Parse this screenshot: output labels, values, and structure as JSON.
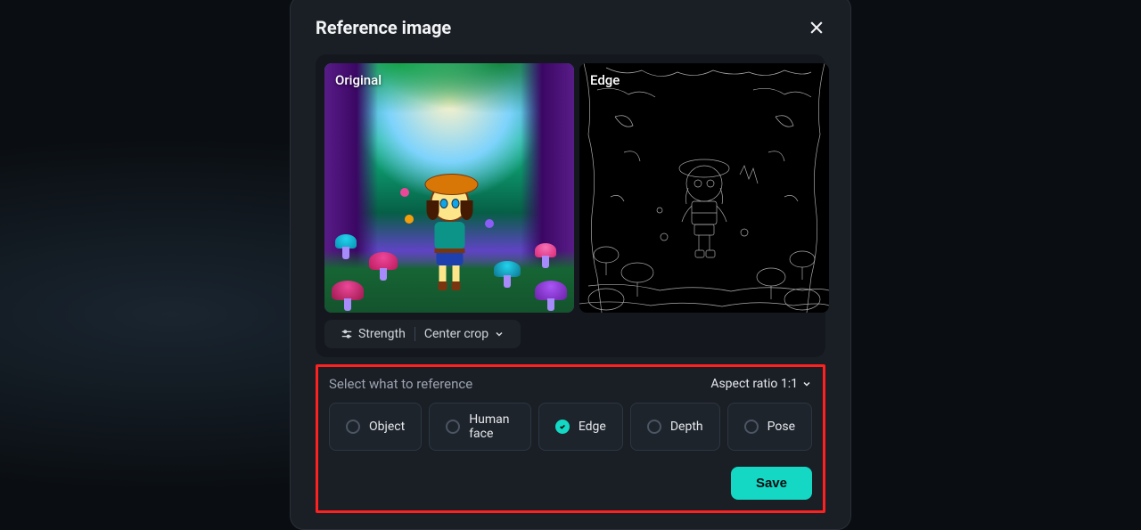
{
  "dialog": {
    "title": "Reference image"
  },
  "images": {
    "original_label": "Original",
    "edge_label": "Edge"
  },
  "toolbar": {
    "strength_label": "Strength",
    "crop_label": "Center crop"
  },
  "reference_section": {
    "title": "Select what to reference",
    "aspect_ratio_label": "Aspect ratio 1:1",
    "options": [
      {
        "label": "Object",
        "selected": false
      },
      {
        "label": "Human face",
        "selected": false
      },
      {
        "label": "Edge",
        "selected": true
      },
      {
        "label": "Depth",
        "selected": false
      },
      {
        "label": "Pose",
        "selected": false
      }
    ]
  },
  "footer": {
    "save_label": "Save"
  }
}
